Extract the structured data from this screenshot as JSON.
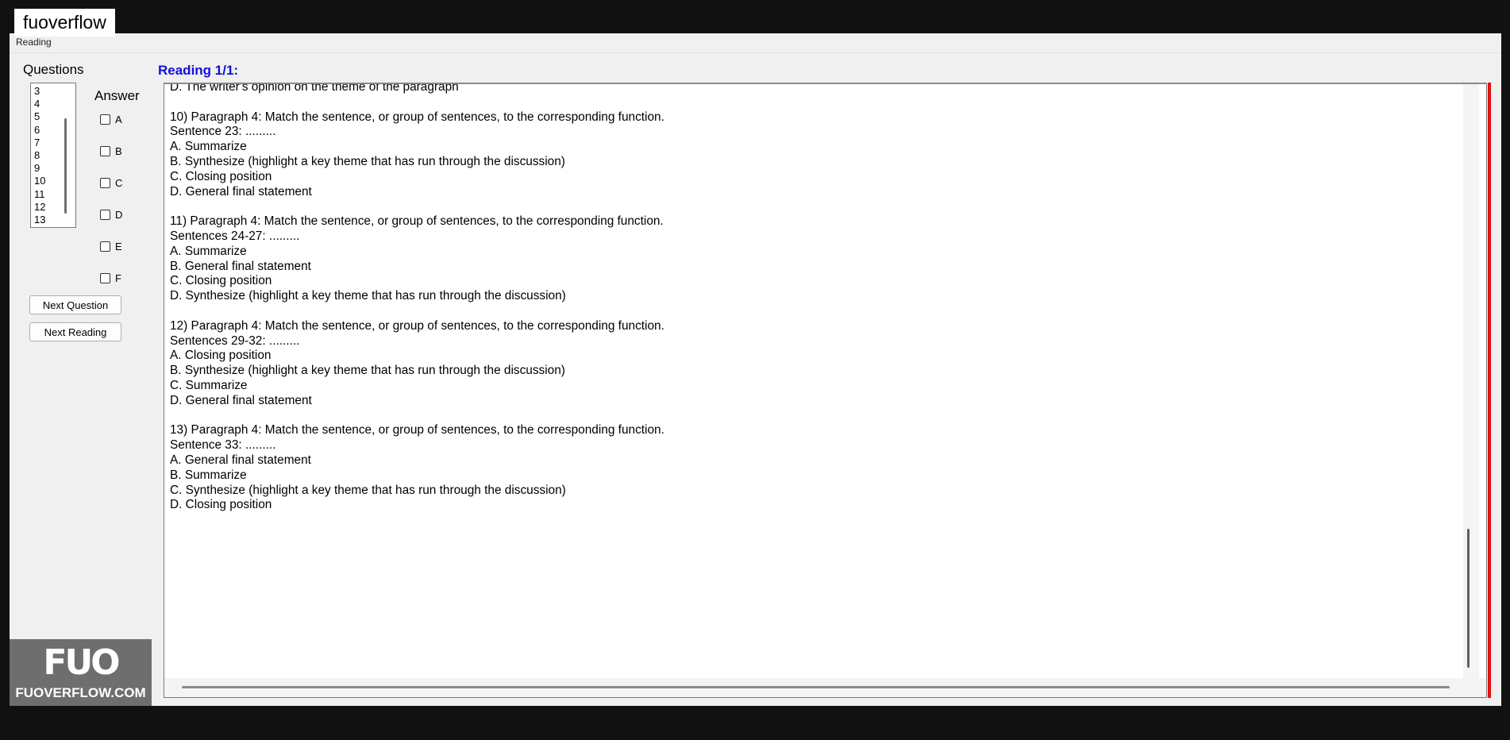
{
  "window": {
    "tab_label": "Reading"
  },
  "watermark": {
    "top_text": "fuoverflow",
    "logo_mark": "FUO",
    "logo_text": "FUOVERFLOW.COM"
  },
  "left": {
    "questions_label": "Questions",
    "question_numbers": [
      "3",
      "4",
      "5",
      "6",
      "7",
      "8",
      "9",
      "10",
      "11",
      "12",
      "13"
    ],
    "answer_label": "Answer",
    "options": [
      "A",
      "B",
      "C",
      "D",
      "E",
      "F"
    ],
    "next_question_label": "Next Question",
    "next_reading_label": "Next Reading"
  },
  "reading": {
    "title": "Reading 1/1:",
    "lines": [
      "D.  The writer's opinion on the theme of the paragraph",
      "",
      "10) Paragraph 4: Match the sentence, or group of sentences, to the corresponding function.",
      "Sentence 23: .........",
      "A.  Summarize",
      "B.  Synthesize (highlight a key theme that has run through the discussion)",
      "C.  Closing position",
      "D.  General final statement",
      "",
      "11) Paragraph 4: Match the sentence, or group of sentences, to the corresponding function.",
      "Sentences 24-27: .........",
      "A.  Summarize",
      "B.  General final statement",
      "C.  Closing position",
      "D.  Synthesize (highlight a key theme that has run through the discussion)",
      "",
      "12) Paragraph 4: Match the sentence, or group of sentences, to the corresponding function.",
      "Sentences 29-32: .........",
      "A.  Closing position",
      "B.  Synthesize (highlight a key theme that has run through the discussion)",
      "C.  Summarize",
      "D.  General final statement",
      "",
      "13) Paragraph 4: Match the sentence, or group of sentences, to the corresponding function.",
      "Sentence 33: .........",
      "A.  General final statement",
      "B.  Summarize",
      "C.  Synthesize (highlight a key theme that has run through the discussion)",
      "D.  Closing position"
    ]
  },
  "colors": {
    "title_blue": "#1010e0",
    "accent_red": "#e01010"
  }
}
